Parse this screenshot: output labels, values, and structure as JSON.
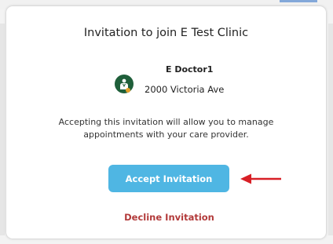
{
  "modal": {
    "title": "Invitation to join E Test Clinic",
    "provider": {
      "name": "E Doctor1",
      "address": "2000 Victoria Ave",
      "avatar_icon": "doctor-avatar-icon"
    },
    "description": "Accepting this invitation will allow you to manage appointments with your care provider.",
    "accept_label": "Accept Invitation",
    "decline_label": "Decline Invitation"
  },
  "annotation": {
    "arrow_icon": "red-arrow-icon"
  },
  "colors": {
    "accept_button": "#4fb6e3",
    "decline_text": "#b23a3a",
    "avatar_bg": "#1f5f3a",
    "arrow": "#d81f26"
  }
}
